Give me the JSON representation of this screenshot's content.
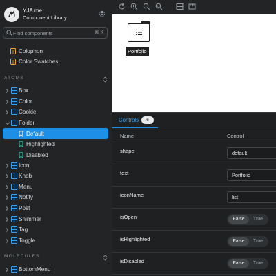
{
  "brand": {
    "title": "YJA.me",
    "subtitle": "Component Library"
  },
  "search": {
    "placeholder": "Find components",
    "shortcut": "⌘ K"
  },
  "sidebar": {
    "docs": [
      "Colophon",
      "Color Swatches"
    ],
    "atoms_title": "ATOMS",
    "atoms": [
      "Box",
      "Color",
      "Cookie",
      "Folder",
      "Icon",
      "Knob",
      "Menu",
      "Notify",
      "Post",
      "Shimmer",
      "Tag",
      "Toggle"
    ],
    "folder_stories": [
      "Default",
      "Highlighted",
      "Disabled"
    ],
    "selected_story": "Default",
    "molecules_title": "MOLECULES",
    "molecules": [
      "BottomMenu"
    ]
  },
  "preview": {
    "folder_label": "Portfolio"
  },
  "addons": {
    "tab_label": "Controls",
    "tab_count": "6",
    "col_name": "Name",
    "col_control": "Control",
    "rows": [
      {
        "name": "shape",
        "value": "default"
      },
      {
        "name": "text",
        "value": "Portfolio"
      },
      {
        "name": "iconName",
        "value": "list"
      },
      {
        "name": "isOpen",
        "false_label": "False",
        "true_label": "True"
      },
      {
        "name": "isHighlighted",
        "false_label": "False",
        "true_label": "True"
      },
      {
        "name": "isDisabled",
        "false_label": "False",
        "true_label": "True"
      }
    ]
  },
  "colors": {
    "accent": "#1e8fe6",
    "sidebar_bg": "#222425",
    "story_icon": "#2bbfa4",
    "component_icon": "#3aa1f0",
    "doc_icon": "#f0a93a"
  }
}
